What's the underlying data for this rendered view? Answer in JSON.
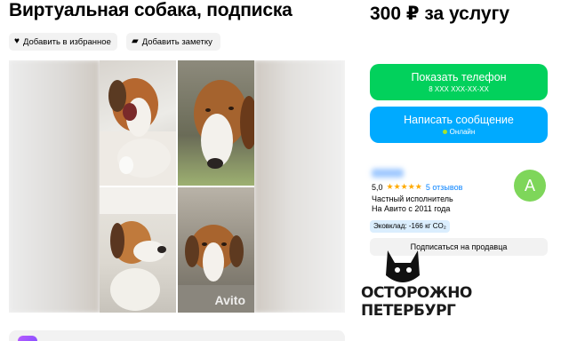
{
  "listing": {
    "title": "Виртуальная собака, подписка",
    "price": "300 ₽ за услугу"
  },
  "actions": {
    "favorite_label": "Добавить в избранное",
    "favorite_icon": "heart-icon",
    "note_label": "Добавить заметку",
    "note_icon": "note-icon"
  },
  "gallery": {
    "watermark": "Avito",
    "photos": [
      "dog-yawning",
      "dog-lying-head",
      "dog-looking-up",
      "dog-on-pillow"
    ]
  },
  "contact": {
    "phone_label": "Показать телефон",
    "phone_masked": "8 XXX XXX-XX-XX",
    "message_label": "Написать сообщение",
    "online_status": "Онлайн",
    "phone_color": "#02d15c",
    "message_color": "#00aaff"
  },
  "seller": {
    "rating": "5,0",
    "stars": "★★★★★",
    "reviews": "5 отзывов",
    "type": "Частный исполнитель",
    "since": "На Авито с 2011 года",
    "avatar_letter": "A",
    "eco": "Эковклад: -166 кг CO₂",
    "subscribe_label": "Подписаться на продавца"
  },
  "logo": {
    "line1": "ОСТОРОЖНО",
    "line2": "ПЕТЕРБУРГ"
  }
}
